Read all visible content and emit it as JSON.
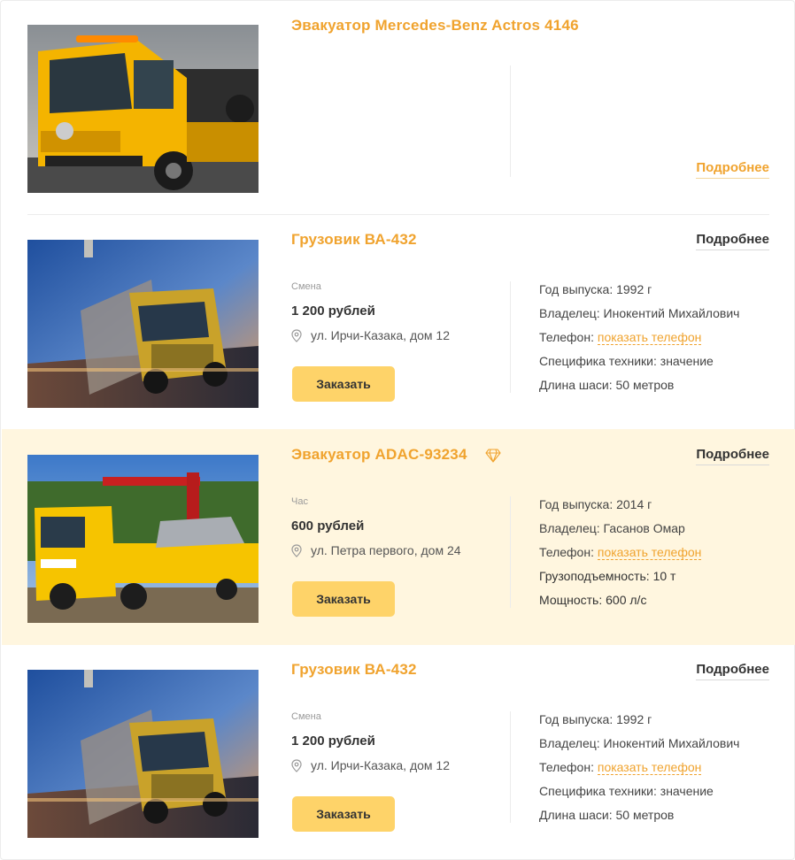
{
  "colors": {
    "accent": "#f0a32e",
    "button": "#fed369",
    "highlight_bg": "#fff6df",
    "divider": "#ececec"
  },
  "listings": [
    {
      "title": "Эвакуатор Mercedes-Benz Actros 4146",
      "more_label": "Подробнее",
      "image": "yellow-mercedes-tow-truck-photo"
    },
    {
      "title": "Грузовик ВА-432",
      "more_label": "Подробнее",
      "image": "volvo-truck-motion-photo",
      "unit": "Смена",
      "price": "1 200 рублей",
      "address": "ул. Ирчи-Казака, дом 12",
      "order_label": "Заказать",
      "specs": [
        {
          "label": "Год выпуска:",
          "value": " 1992 г"
        },
        {
          "label": "Владелец:",
          "value": "Инокентий Михайлович"
        },
        {
          "label": "Телефон:",
          "link": "показать телефон"
        },
        {
          "label": "Специфика техники:",
          "value": "значение"
        },
        {
          "label": "Длина шаси:",
          "value": "50 метров"
        }
      ]
    },
    {
      "title": "Эвакуатор ADAC-93234",
      "premium_icon": "diamond-icon",
      "more_label": "Подробнее",
      "image": "adac-tow-truck-crane-photo",
      "unit": "Час",
      "price": "600 рублей",
      "address": "ул. Петра первого, дом 24",
      "order_label": "Заказать",
      "specs": [
        {
          "label": "Год выпуска:",
          "value": " 2014 г"
        },
        {
          "label": "Владелец:",
          "value": "Гасанов Омар"
        },
        {
          "label": "Телефон:",
          "link": "показать телефон"
        },
        {
          "label": "Грузоподъемность:",
          "value": "10 т"
        },
        {
          "label": "Мощность:",
          "value": "600 л/с"
        }
      ]
    },
    {
      "title": "Грузовик ВА-432",
      "more_label": "Подробнее",
      "image": "volvo-truck-motion-photo",
      "unit": "Смена",
      "price": "1 200 рублей",
      "address": "ул. Ирчи-Казака, дом 12",
      "order_label": "Заказать",
      "specs": [
        {
          "label": "Год выпуска:",
          "value": " 1992 г"
        },
        {
          "label": "Владелец:",
          "value": "Инокентий Михайлович"
        },
        {
          "label": "Телефон:",
          "link": "показать телефон"
        },
        {
          "label": "Специфика техники:",
          "value": "значение"
        },
        {
          "label": "Длина шаси:",
          "value": "50 метров"
        }
      ]
    }
  ]
}
